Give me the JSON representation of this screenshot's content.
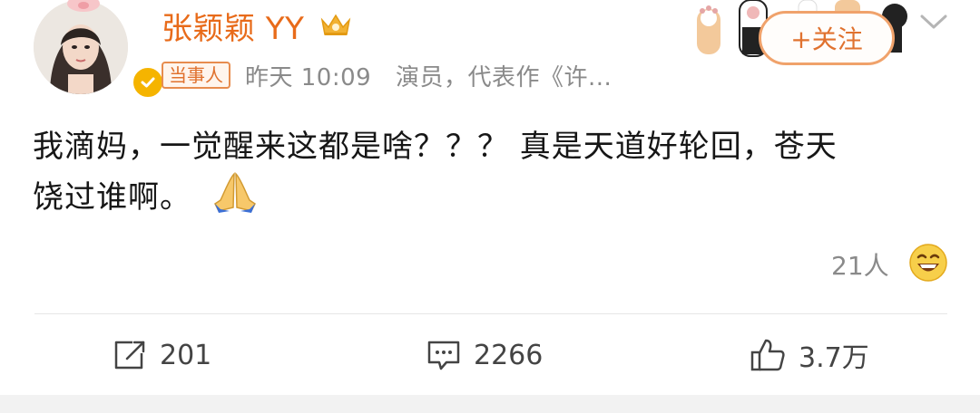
{
  "post": {
    "author": {
      "name": "张颖颖 YY",
      "role_tag": "当事人",
      "time": "昨天 10:09",
      "description": "演员，代表作《许..."
    },
    "follow_label": "+关注",
    "content_line1": "我滴妈，一觉醒来这都是啥？？？ 真是天道好轮回，苍天",
    "content_line2": "饶过谁啊。",
    "reactions_count": "21人",
    "actions": {
      "repost": "201",
      "comment": "2266",
      "like": "3.7万"
    }
  },
  "colors": {
    "accent": "#e86b1a",
    "tag_border": "#e78c4e",
    "verified": "#f5b400",
    "muted_text": "#8a8a8a"
  },
  "icons": [
    "verified-badge-icon",
    "crown-icon",
    "chevron-down-icon",
    "prayer-hands-icon",
    "laughing-emoji-icon",
    "repost-icon",
    "comment-icon",
    "like-icon"
  ]
}
